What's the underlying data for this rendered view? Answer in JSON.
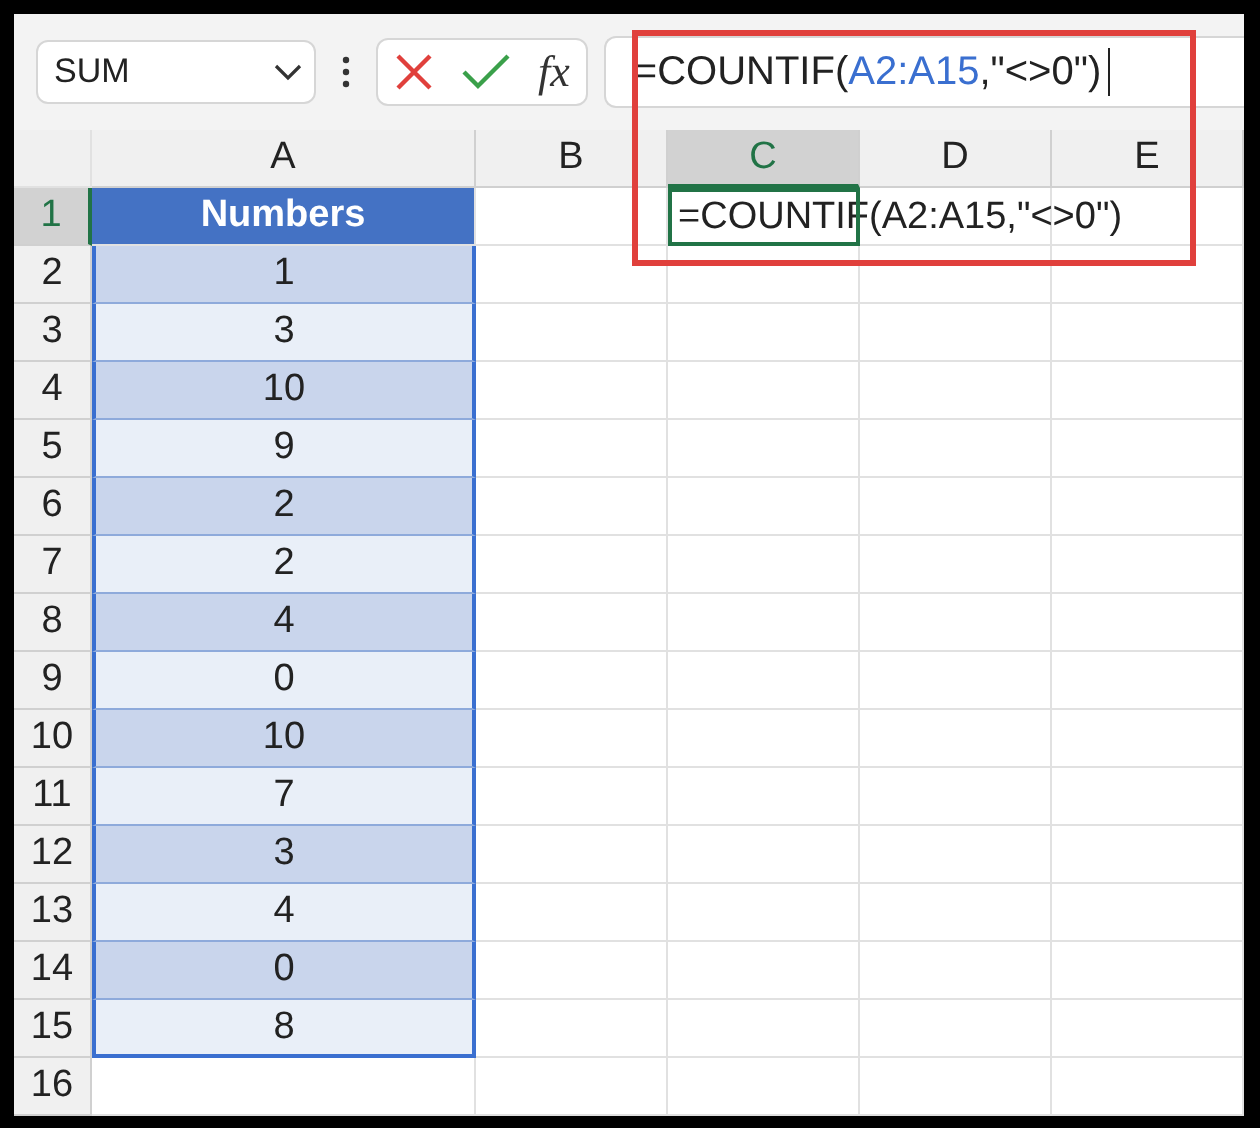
{
  "name_box": {
    "value": "SUM"
  },
  "function_button": {
    "label": "fx"
  },
  "formula_bar": {
    "parts": [
      {
        "text": "=COUNTIF(",
        "kind": "plain"
      },
      {
        "text": "A2:A15",
        "kind": "ref"
      },
      {
        "text": ",\"<>0\")",
        "kind": "plain"
      }
    ]
  },
  "columns": [
    {
      "label": "A",
      "selected": false
    },
    {
      "label": "B",
      "selected": false
    },
    {
      "label": "C",
      "selected": true
    },
    {
      "label": "D",
      "selected": false
    },
    {
      "label": "E",
      "selected": false
    }
  ],
  "rows": [
    {
      "label": "1",
      "selected": true,
      "column_a": {
        "text": "Numbers",
        "kind": "header"
      },
      "column_c": {
        "text": "=COUNTIF(A2:A15,\"<>0\")",
        "selected": true
      }
    },
    {
      "label": "2",
      "selected": false,
      "column_a": {
        "text": "1",
        "kind": "dark"
      }
    },
    {
      "label": "3",
      "selected": false,
      "column_a": {
        "text": "3",
        "kind": "light"
      }
    },
    {
      "label": "4",
      "selected": false,
      "column_a": {
        "text": "10",
        "kind": "dark"
      }
    },
    {
      "label": "5",
      "selected": false,
      "column_a": {
        "text": "9",
        "kind": "light"
      }
    },
    {
      "label": "6",
      "selected": false,
      "column_a": {
        "text": "2",
        "kind": "dark"
      }
    },
    {
      "label": "7",
      "selected": false,
      "column_a": {
        "text": "2",
        "kind": "light"
      }
    },
    {
      "label": "8",
      "selected": false,
      "column_a": {
        "text": "4",
        "kind": "dark"
      }
    },
    {
      "label": "9",
      "selected": false,
      "column_a": {
        "text": "0",
        "kind": "light"
      }
    },
    {
      "label": "10",
      "selected": false,
      "column_a": {
        "text": "10",
        "kind": "dark"
      }
    },
    {
      "label": "11",
      "selected": false,
      "column_a": {
        "text": "7",
        "kind": "light"
      }
    },
    {
      "label": "12",
      "selected": false,
      "column_a": {
        "text": "3",
        "kind": "dark"
      }
    },
    {
      "label": "13",
      "selected": false,
      "column_a": {
        "text": "4",
        "kind": "light"
      }
    },
    {
      "label": "14",
      "selected": false,
      "column_a": {
        "text": "0",
        "kind": "dark"
      }
    },
    {
      "label": "15",
      "selected": false,
      "column_a": {
        "text": "8",
        "kind": "light"
      }
    },
    {
      "label": "16",
      "selected": false
    }
  ]
}
